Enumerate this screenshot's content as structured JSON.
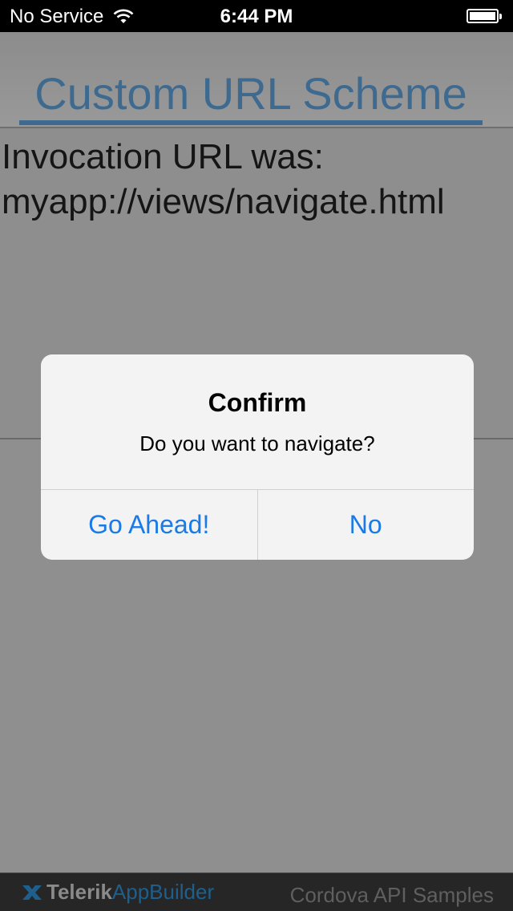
{
  "status_bar": {
    "carrier": "No Service",
    "time": "6:44 PM",
    "wifi_icon": "wifi-icon",
    "battery_icon": "battery-icon"
  },
  "header": {
    "title": "Custom URL Scheme"
  },
  "content": {
    "line1": "Invocation URL was:",
    "line2": "myapp://views/navigate.html"
  },
  "dialog": {
    "title": "Confirm",
    "message": "Do you want to navigate?",
    "buttons": [
      "Go Ahead!",
      "No"
    ]
  },
  "footer": {
    "brand_part1": "Telerik",
    "brand_part2": "AppBuilder",
    "title": "Cordova API Samples"
  },
  "colors": {
    "accent": "#3f6a90",
    "dialog_button": "#1a7ae6"
  }
}
